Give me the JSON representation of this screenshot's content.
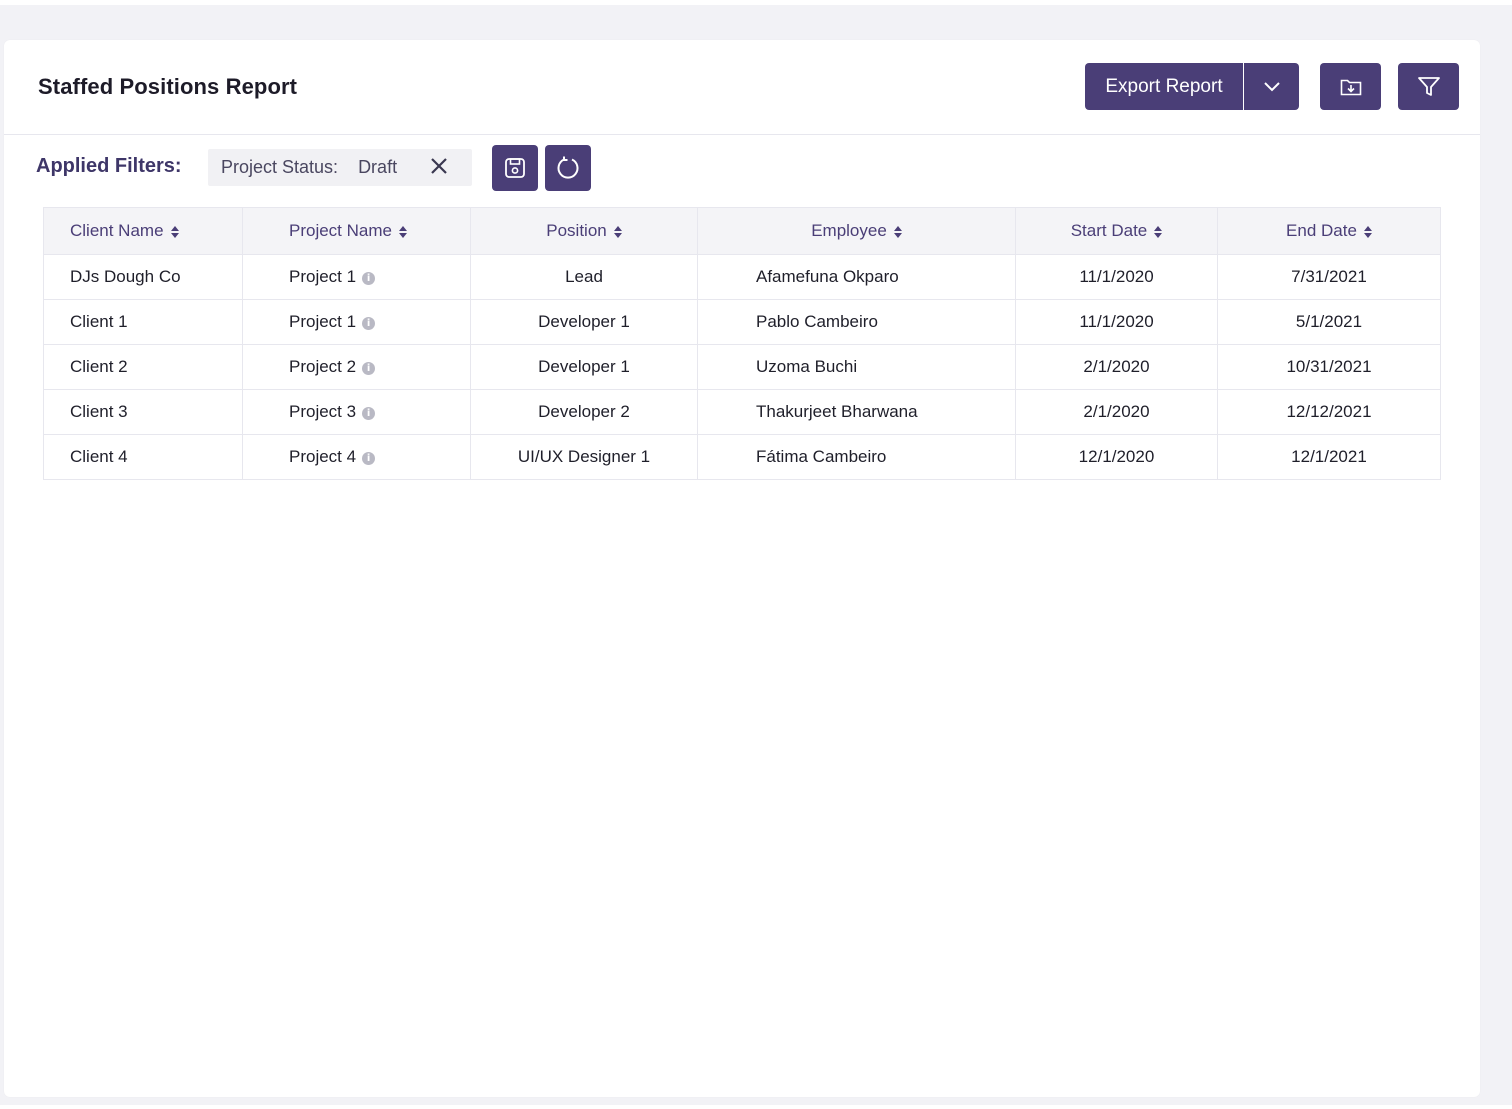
{
  "report": {
    "title": "Staffed Positions Report",
    "export_label": "Export Report"
  },
  "filters": {
    "label": "Applied Filters:",
    "chip_key": "Project Status:",
    "chip_value": "Draft"
  },
  "table": {
    "headers": [
      "Client Name",
      "Project Name",
      "Position",
      "Employee",
      "Start Date",
      "End Date"
    ],
    "rows": [
      {
        "client": "DJs Dough Co",
        "project": "Project 1",
        "position": "Lead",
        "employee": "Afamefuna Okparo",
        "start": "11/1/2020",
        "end": "7/31/2021"
      },
      {
        "client": "Client 1",
        "project": "Project 1",
        "position": "Developer 1",
        "employee": "Pablo Cambeiro",
        "start": "11/1/2020",
        "end": "5/1/2021"
      },
      {
        "client": "Client 2",
        "project": "Project 2",
        "position": "Developer 1",
        "employee": "Uzoma Buchi",
        "start": "2/1/2020",
        "end": "10/31/2021"
      },
      {
        "client": "Client 3",
        "project": "Project 3",
        "position": "Developer 2",
        "employee": "Thakurjeet Bharwana",
        "start": "2/1/2020",
        "end": "12/12/2021"
      },
      {
        "client": "Client 4",
        "project": "Project 4",
        "position": "UI/UX Designer 1",
        "employee": "Fátima Cambeiro",
        "start": "12/1/2020",
        "end": "12/1/2021"
      }
    ]
  },
  "icons": {
    "export_caret": "chevron-down-icon",
    "folder": "folder-download-icon",
    "filter": "funnel-icon",
    "chip_close": "close-icon",
    "save": "save-icon",
    "reset": "refresh-icon",
    "sort": "sort-icon",
    "info": "info-icon"
  },
  "colors": {
    "accent": "#4a3e77",
    "header_bg": "#f4f4f7",
    "chip_bg": "#f1f1f4",
    "page_bg": "#f2f2f6"
  }
}
